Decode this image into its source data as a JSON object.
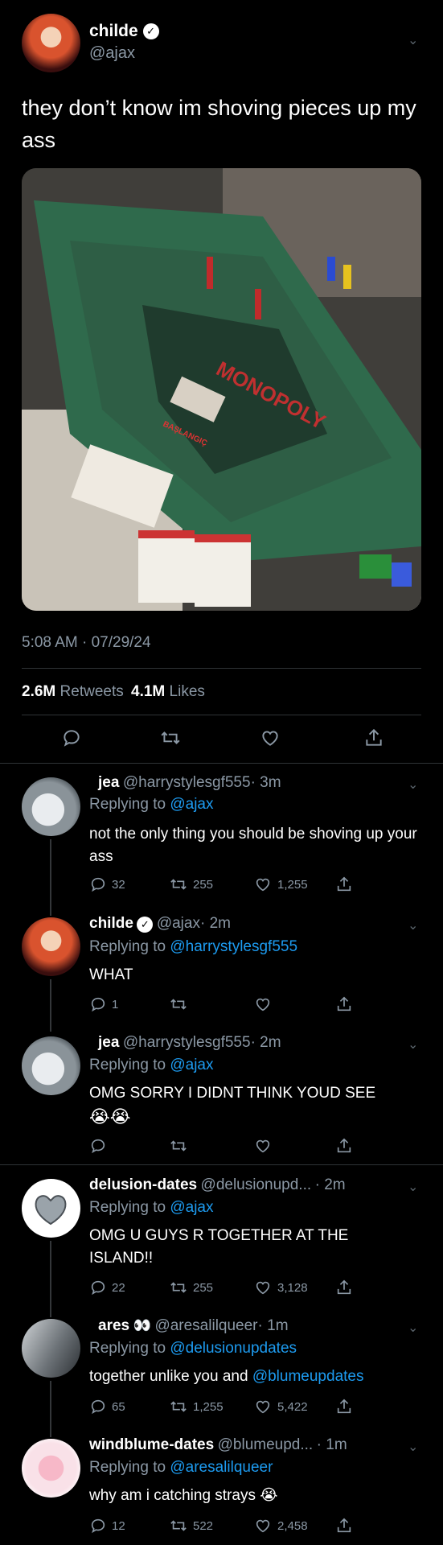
{
  "main_tweet": {
    "display_name": "childe",
    "handle": "@ajax",
    "text": "they don’t know im shoving pieces up my ass",
    "timestamp": "5:08 AM · 07/29/24",
    "retweets_count": "2.6M",
    "retweets_label": "Retweets",
    "likes_count": "4.1M",
    "likes_label": "Likes",
    "image_text": {
      "board_brand": "MONOPOLY",
      "start_space": "BAŞLANGIÇ"
    }
  },
  "replying_to_label": "Replying to",
  "replies": [
    {
      "display_name": "jea",
      "handle": "@harrystylesgf555",
      "time": "· 3m",
      "replying_to": "@ajax",
      "text": "not the only thing you should be shoving up your ass",
      "replies": "32",
      "retweets": "255",
      "likes": "1,255"
    },
    {
      "display_name": "childe",
      "handle": "@ajax",
      "time": "· 2m",
      "replying_to": "@harrystylesgf555",
      "text": "WHAT",
      "replies": "1",
      "retweets": "",
      "likes": ""
    },
    {
      "display_name": "jea",
      "handle": "@harrystylesgf555",
      "time": "· 2m",
      "replying_to": "@ajax",
      "text": "OMG SORRY I DIDNT THINK YOUD SEE",
      "emoji": "😭😭",
      "replies": "",
      "retweets": "",
      "likes": ""
    },
    {
      "display_name": "delusion-dates",
      "handle": "@delusionupd...",
      "time": "· 2m",
      "replying_to": "@ajax",
      "text": "OMG U GUYS R TOGETHER AT THE ISLAND!!",
      "replies": "22",
      "retweets": "255",
      "likes": "3,128"
    },
    {
      "display_name": "ares",
      "name_emoji": "👀",
      "handle": "@aresalilqueer",
      "time": "· 1m",
      "replying_to": "@delusionupdates",
      "text_prefix": "together unlike you and",
      "text_mention": "@blumeupdates",
      "replies": "65",
      "retweets": "1,255",
      "likes": "5,422"
    },
    {
      "display_name": "windblume-dates",
      "handle": "@blumeupd...",
      "time": "· 1m",
      "replying_to": "@aresalilqueer",
      "text": "why am i catching strays",
      "emoji": "😭",
      "replies": "12",
      "retweets": "522",
      "likes": "2,458"
    }
  ],
  "icons": {
    "reply": "reply-icon",
    "retweet": "retweet-icon",
    "like": "heart-icon",
    "share": "share-icon",
    "menu": "chevron-down-icon",
    "verified": "verified-badge-icon"
  },
  "colors": {
    "background": "#000000",
    "text": "#ffffff",
    "muted": "#8b98a5",
    "link": "#1d9bf0",
    "divider": "#2f3336"
  }
}
